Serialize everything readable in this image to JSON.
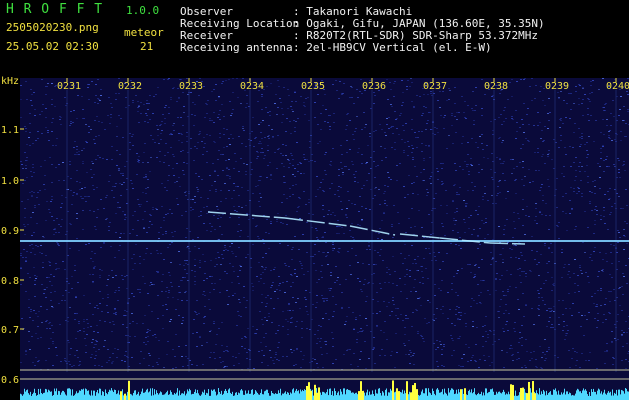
{
  "header": {
    "app_title": "H R O F F T",
    "version": "1.0.0",
    "filename": "2505020230.png",
    "datetime": "25.05.02 02:30",
    "meteor_label": "meteor",
    "meteor_count": "21",
    "info_labels": [
      "Observer",
      "Receiving Location",
      "Receiver",
      "Receiving antenna"
    ],
    "info_values": [
      ": Takanori Kawachi",
      ": Ogaki, Gifu, JAPAN (136.60E, 35.35N)",
      ": R820T2(RTL-SDR) SDR-Sharp 53.372MHz",
      ": 2el-HB9CV Vertical (el. E-W)"
    ]
  },
  "plot": {
    "y_unit": "kHz",
    "time_ticks": [
      "0231",
      "0232",
      "0233",
      "0234",
      "0235",
      "0236",
      "0237",
      "0238",
      "0239",
      "0240"
    ],
    "freq_ticks": [
      "1.1",
      "1.0",
      "0.9",
      "0.8",
      "0.7",
      "0.6"
    ],
    "colors": {
      "background": "#0a0a3a",
      "noise": "#2a3aa0",
      "carrier": "#7fd0ff",
      "meteor": "#b0e8ff",
      "signal_bars": "#4fd8ff",
      "signal_peaks": "#ffff40"
    }
  }
}
